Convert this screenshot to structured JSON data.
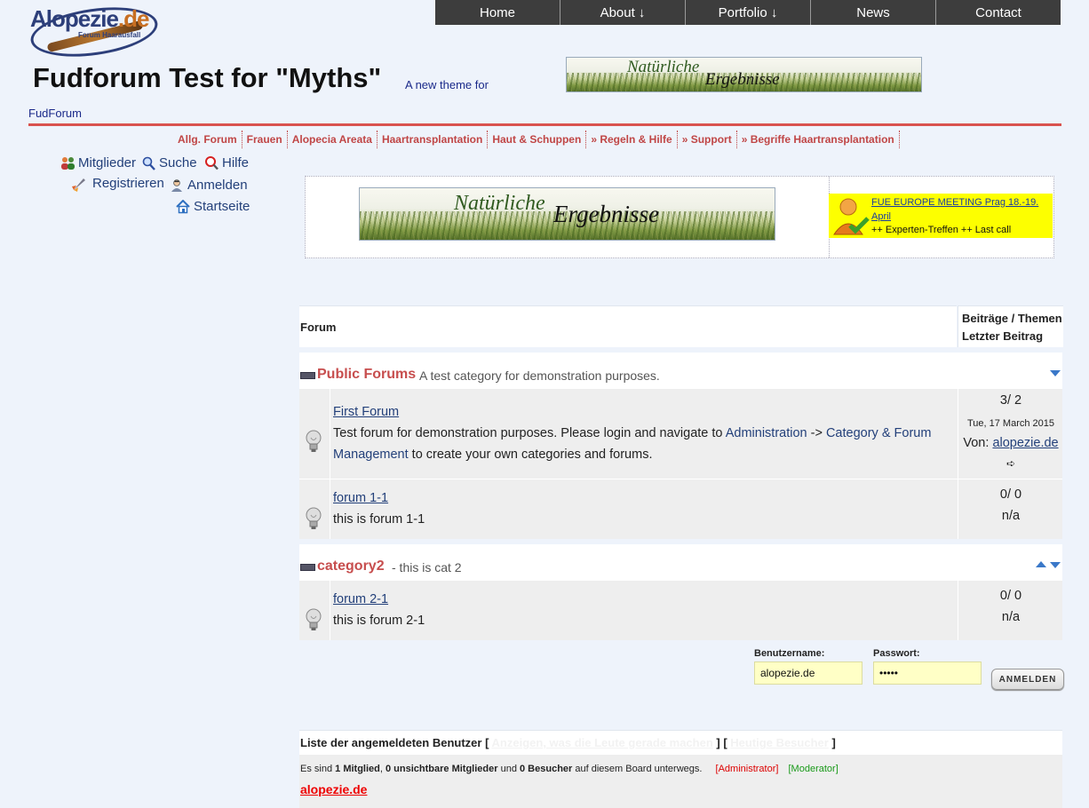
{
  "logo": {
    "word_a": "Alopezie",
    "word_b": ".de",
    "sub": "Forum Haarausfall"
  },
  "topnav": [
    "Home",
    "About ↓",
    "Portfolio ↓",
    "News",
    "Contact"
  ],
  "title": {
    "main": "Fudforum Test for \"Myths\"",
    "sub": "A new theme for",
    "sub2": "FudForum"
  },
  "banner": {
    "line1": "Natürliche",
    "line2": "Ergebnisse"
  },
  "catnav": [
    "Allg. Forum",
    "Frauen",
    "Alopecia Areata",
    "Haartransplantation",
    "Haut & Schuppen",
    "» Regeln & Hilfe",
    "» Support",
    "» Begriffe Haartransplantation"
  ],
  "usermenu": {
    "members": "Mitglieder",
    "search": "Suche",
    "help": "Hilfe",
    "register": "Registrieren",
    "login": "Anmelden",
    "home": "Startseite"
  },
  "promo": {
    "link": "FUE EUROPE MEETING Prag 18.-19. April",
    "text": "++ Experten-Treffen ++ Last call"
  },
  "table": {
    "col_forum": "Forum",
    "col_stats_a": "Beiträge / Themen",
    "col_stats_b": "Letzter Beitrag"
  },
  "categories": [
    {
      "name": "Public Forums",
      "desc": "A test category for demonstration purposes."
    },
    {
      "name": "category2",
      "desc": "- this is cat 2"
    }
  ],
  "forums": [
    {
      "name": "First Forum",
      "desc_a": "Test forum for demonstration purposes. Please login and navigate to ",
      "desc_link1": "Administration",
      "desc_b": " -> ",
      "desc_link2": "Category & Forum Management",
      "desc_c": " to create your own categories and forums.",
      "count": "3/ 2",
      "date": "Tue, 17 March 2015",
      "by_label": "Von: ",
      "by_user": "alopezie.de",
      "goto": "➪"
    },
    {
      "name": "forum 1-1",
      "desc": "this is forum 1-1",
      "count": "0/ 0",
      "last": "n/a"
    },
    {
      "name": "forum 2-1",
      "desc": "this is forum 2-1",
      "count": "0/ 0",
      "last": "n/a"
    }
  ],
  "login": {
    "user_label": "Benutzername:",
    "user_value": "alopezie.de",
    "pass_label": "Passwort:",
    "pass_value": "•••••",
    "button": "ANMELDEN"
  },
  "online": {
    "title": "Liste der angemeldeten Benutzer",
    "open1": " [ ",
    "link1": "Anzeigen, was die Leute gerade machen",
    "mid": " ] [ ",
    "link2": "Heutige Besucher",
    "close": " ]",
    "l_a": "Es sind ",
    "members": "1 Mitglied",
    "l_b": ", ",
    "hidden": "0 unsichtbare Mitglieder",
    "l_c": " und ",
    "guests": "0 Besucher",
    "l_d": " auf diesem Board unterwegs.",
    "admin": "[Administrator]",
    "mod": "[Moderator]",
    "user": "alopezie.de"
  },
  "colors": {
    "accent_red": "#c74e4e",
    "nav_bg": "#3d3d3d",
    "link_blue": "#23407a",
    "promo_yellow": "#fdff00"
  }
}
